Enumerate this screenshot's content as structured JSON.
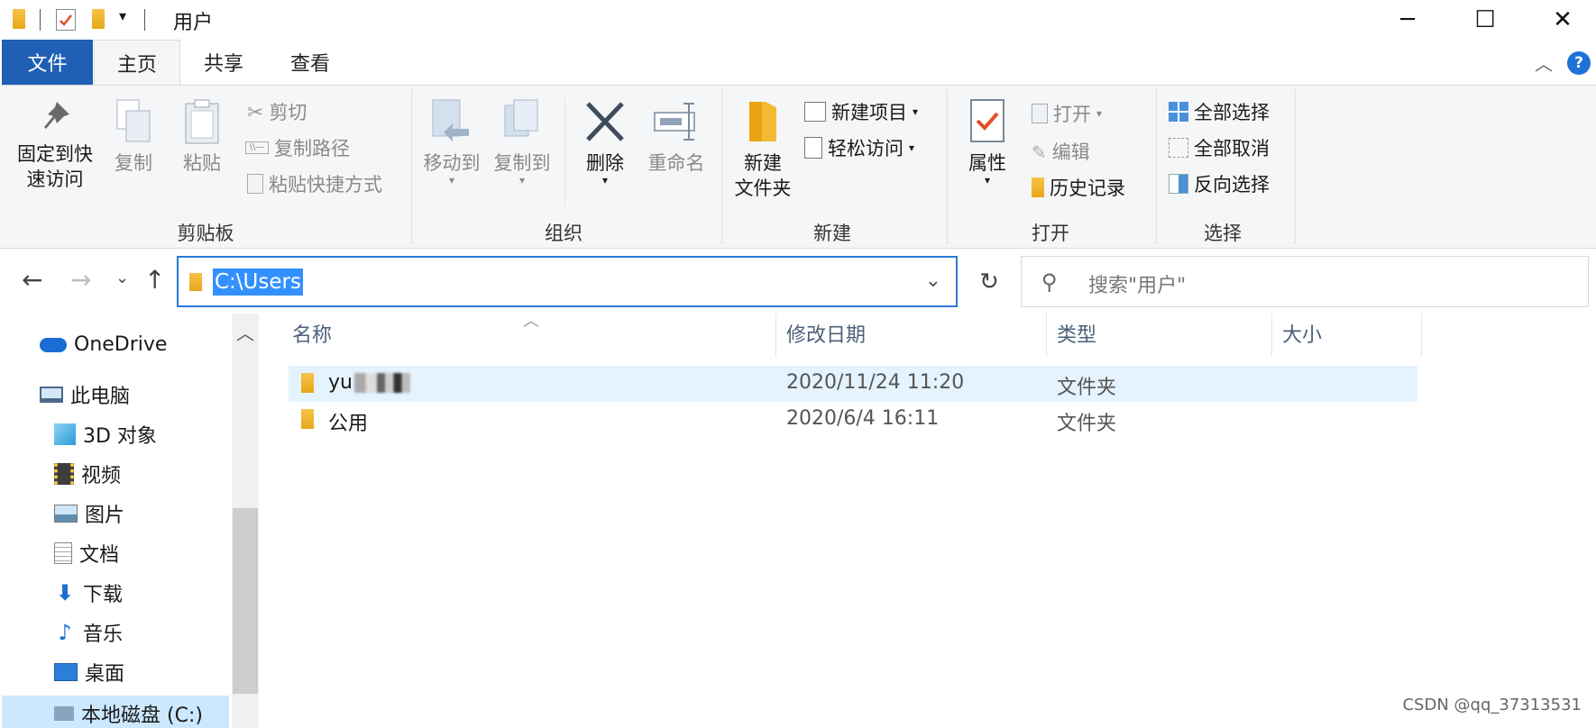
{
  "window": {
    "title": "用户",
    "minimize": "─",
    "maximize": "☐",
    "close": "✕"
  },
  "tabs": {
    "file": "文件",
    "home": "主页",
    "share": "共享",
    "view": "查看",
    "collapse": "︿",
    "help": "?"
  },
  "ribbon": {
    "clipboard": {
      "label": "剪贴板",
      "pin": "固定到快\n速访问",
      "copy": "复制",
      "paste": "粘贴",
      "cut": "剪切",
      "copy_path": "复制路径",
      "paste_shortcut": "粘贴快捷方式"
    },
    "organize": {
      "label": "组织",
      "move_to": "移动到",
      "copy_to": "复制到",
      "delete": "删除",
      "rename": "重命名"
    },
    "new": {
      "label": "新建",
      "new_folder": "新建\n文件夹",
      "new_item": "新建项目",
      "easy_access": "轻松访问"
    },
    "open": {
      "label": "打开",
      "properties": "属性",
      "open": "打开",
      "edit": "编辑",
      "history": "历史记录"
    },
    "select": {
      "label": "选择",
      "select_all": "全部选择",
      "select_none": "全部取消",
      "invert": "反向选择"
    }
  },
  "address": {
    "path": "C:\\Users",
    "search_placeholder": "搜索\"用户\""
  },
  "nav_pane": {
    "items": [
      {
        "label": "OneDrive"
      },
      {
        "label": "此电脑"
      },
      {
        "label": "3D 对象"
      },
      {
        "label": "视频"
      },
      {
        "label": "图片"
      },
      {
        "label": "文档"
      },
      {
        "label": "下载"
      },
      {
        "label": "音乐"
      },
      {
        "label": "桌面"
      },
      {
        "label": "本地磁盘 (C:)"
      }
    ]
  },
  "columns": {
    "name": "名称",
    "date": "修改日期",
    "type": "类型",
    "size": "大小"
  },
  "files": [
    {
      "name": "yu",
      "date": "2020/11/24 11:20",
      "type": "文件夹",
      "size": ""
    },
    {
      "name": "公用",
      "date": "2020/6/4 16:11",
      "type": "文件夹",
      "size": ""
    }
  ],
  "watermark": "CSDN @qq_37313531"
}
